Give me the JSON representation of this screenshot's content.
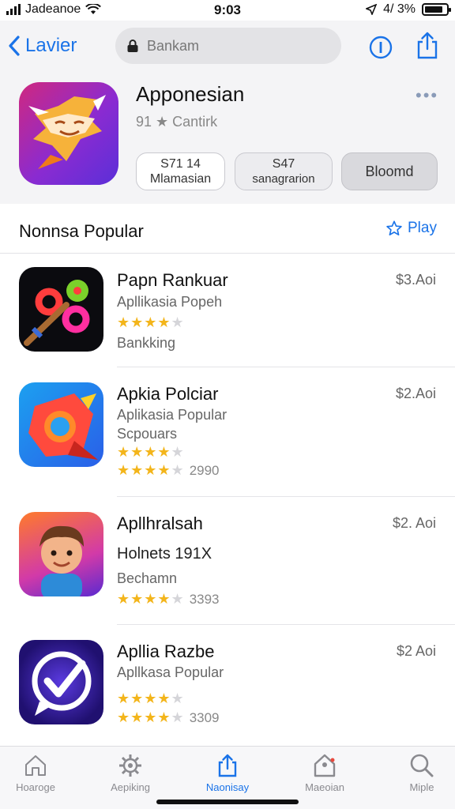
{
  "status_bar": {
    "carrier": "Jadeanoe",
    "time": "9:03",
    "battery_text": "4/ 3%"
  },
  "header": {
    "back_label": "Lavier",
    "search_placeholder": "Bankam"
  },
  "app": {
    "name": "Apponesian",
    "subtitle": "91 ★ Cantirk",
    "stats": [
      {
        "line1": "S71 14",
        "line2": "Mlamasian"
      },
      {
        "line1": "S47",
        "line2": "sanagrarion"
      }
    ],
    "action_label": "Bloomd"
  },
  "section": {
    "title": "Nonnsa Popular",
    "see_all_label": "Play"
  },
  "rows": [
    {
      "name": "Papn Rankuar",
      "price": "$3.Aoi",
      "subtitle": "Apllikasia Popeh",
      "stars_1": 4,
      "category": "Bankking"
    },
    {
      "name": "Apkia Polciar",
      "price": "$2.Aoi",
      "subtitle": "Aplikasia Popular",
      "category": "Scpouars",
      "stars_1": 4,
      "stars_2": 4,
      "rating_count": "2990"
    },
    {
      "name": "Apllhralsah",
      "price": "$2. Aoi",
      "subtitle": "Holnets 191X",
      "category": "Bechamn",
      "stars_1": 4,
      "rating_count": "3393"
    },
    {
      "name": "Apllia Razbe",
      "price": "$2 Aoi",
      "subtitle": "Apllkasa Popular",
      "stars_1": 4,
      "stars_2": 4,
      "rating_count": "3309"
    }
  ],
  "tabs": [
    {
      "label": "Hoaroge",
      "icon": "home-icon"
    },
    {
      "label": "Aepiking",
      "icon": "gear-icon"
    },
    {
      "label": "Naonisay",
      "icon": "share-icon",
      "active": true
    },
    {
      "label": "Maeoian",
      "icon": "tag-icon"
    },
    {
      "label": "Miple",
      "icon": "search-icon"
    }
  ],
  "colors": {
    "accent": "#1a73e8",
    "star": "#f3b51b"
  }
}
